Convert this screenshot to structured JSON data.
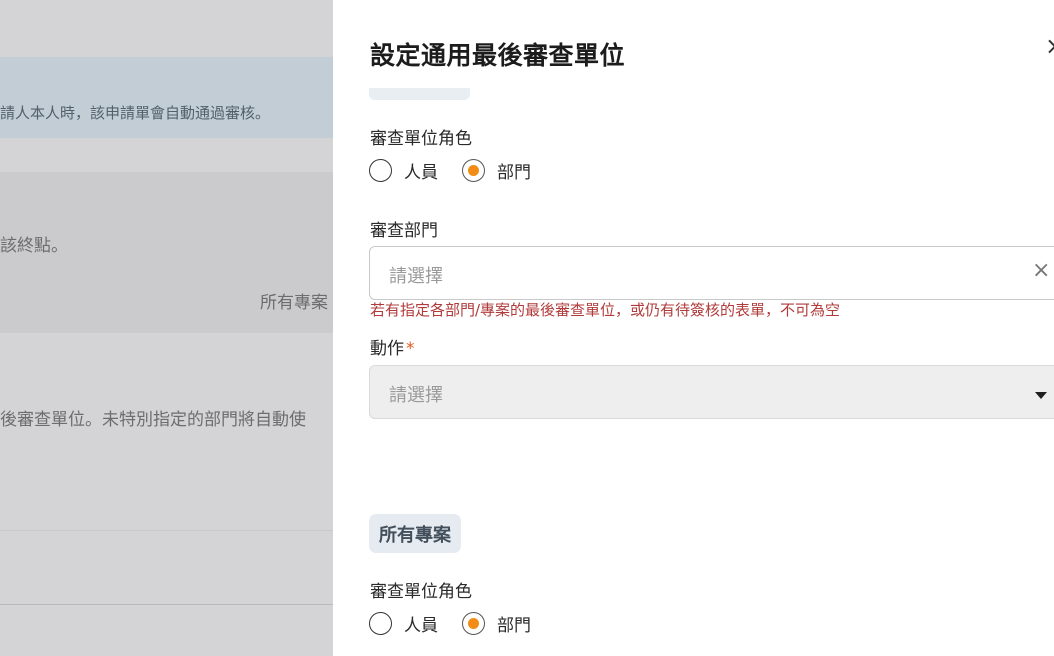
{
  "background": {
    "banner_text": "請人本人時，該申請單會自動通過審核。",
    "text_endpoint": "該終點。",
    "text_all_projects": "所有專案",
    "text_final_review": "後審查單位。未特別指定的部門將自動使"
  },
  "drawer": {
    "title": "設定通用最後審查單位",
    "close_label": "×",
    "section1": {
      "role_label": "審查單位角色",
      "role_options": [
        "人員",
        "部門"
      ],
      "role_selected": "部門",
      "dept_label": "審查部門",
      "dept_placeholder": "請選擇",
      "dept_clear_label": "×",
      "dept_error": "若有指定各部門/專案的最後審查單位，或仍有待簽核的表單，不可為空",
      "action_label": "動作",
      "action_required": "*",
      "action_placeholder": "請選擇"
    },
    "section2": {
      "chip_label": "所有專案",
      "role_label": "審查單位角色",
      "role_options": [
        "人員",
        "部門"
      ],
      "role_selected": "部門"
    }
  },
  "colors": {
    "accent": "#f28c16",
    "error": "#b13b3b",
    "chip_bg": "#e5ebf1"
  }
}
